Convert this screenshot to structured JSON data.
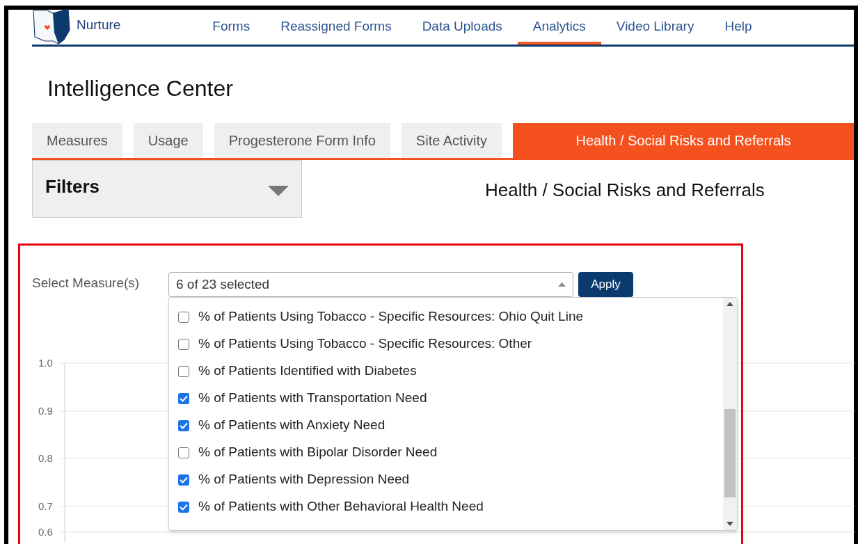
{
  "brand": "Nurture",
  "nav": [
    {
      "label": "Forms",
      "selected": false
    },
    {
      "label": "Reassigned Forms",
      "selected": false
    },
    {
      "label": "Data Uploads",
      "selected": false
    },
    {
      "label": "Analytics",
      "selected": true
    },
    {
      "label": "Video Library",
      "selected": false
    },
    {
      "label": "Help",
      "selected": false
    }
  ],
  "page_title": "Intelligence Center",
  "tabs": [
    {
      "label": "Measures",
      "selected": false
    },
    {
      "label": "Usage",
      "selected": false
    },
    {
      "label": "Progesterone Form Info",
      "selected": false
    },
    {
      "label": "Site Activity",
      "selected": false
    },
    {
      "label": "Health / Social Risks and Referrals",
      "selected": true
    }
  ],
  "filters": {
    "title": "Filters",
    "expanded": false
  },
  "section_title": "Health / Social Risks and Referrals",
  "measure_select": {
    "label": "Select Measure(s)",
    "value": "6 of 23 selected",
    "expanded": true,
    "button": "Apply",
    "options": [
      {
        "label": "% of Patients Using Tobacco - Specific Resources: Ohio Quit Line",
        "checked": false
      },
      {
        "label": "% of Patients Using Tobacco - Specific Resources: Other",
        "checked": false
      },
      {
        "label": "% of Patients Identified with Diabetes",
        "checked": false
      },
      {
        "label": "% of Patients with Transportation Need",
        "checked": true
      },
      {
        "label": "% of Patients with Anxiety Need",
        "checked": true
      },
      {
        "label": "% of Patients with Bipolar Disorder Need",
        "checked": false
      },
      {
        "label": "% of Patients with Depression Need",
        "checked": true
      },
      {
        "label": "% of Patients with Other Behavioral Health Need",
        "checked": true
      }
    ]
  },
  "chart_axis": {
    "y_ticks": [
      "1.0",
      "0.9",
      "0.8",
      "0.7",
      "0.6"
    ]
  }
}
